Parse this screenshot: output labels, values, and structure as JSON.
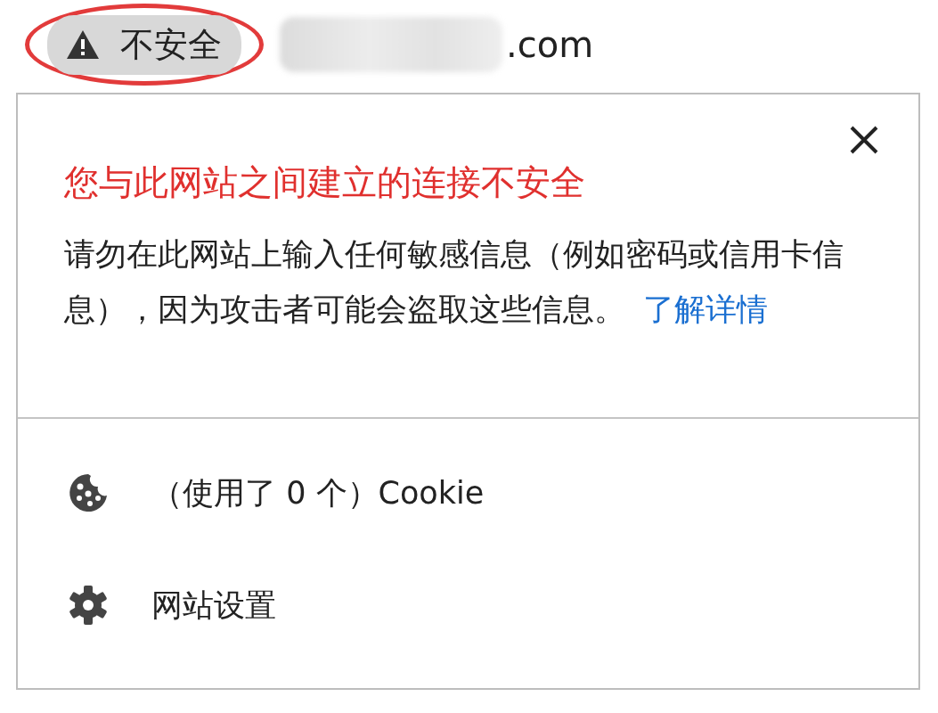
{
  "address_bar": {
    "security_label": "不安全",
    "highlighted": true,
    "domain_suffix": ".com"
  },
  "popup": {
    "title": "您与此网站之间建立的连接不安全",
    "message": "请勿在此网站上输入任何敏感信息（例如密码或信用卡信息），因为攻击者可能会盗取这些信息。",
    "link": "了解详情",
    "items": [
      {
        "kind": "cookie",
        "label": "（使用了 0 个）Cookie"
      },
      {
        "kind": "settings",
        "label": "网站设置"
      }
    ]
  }
}
